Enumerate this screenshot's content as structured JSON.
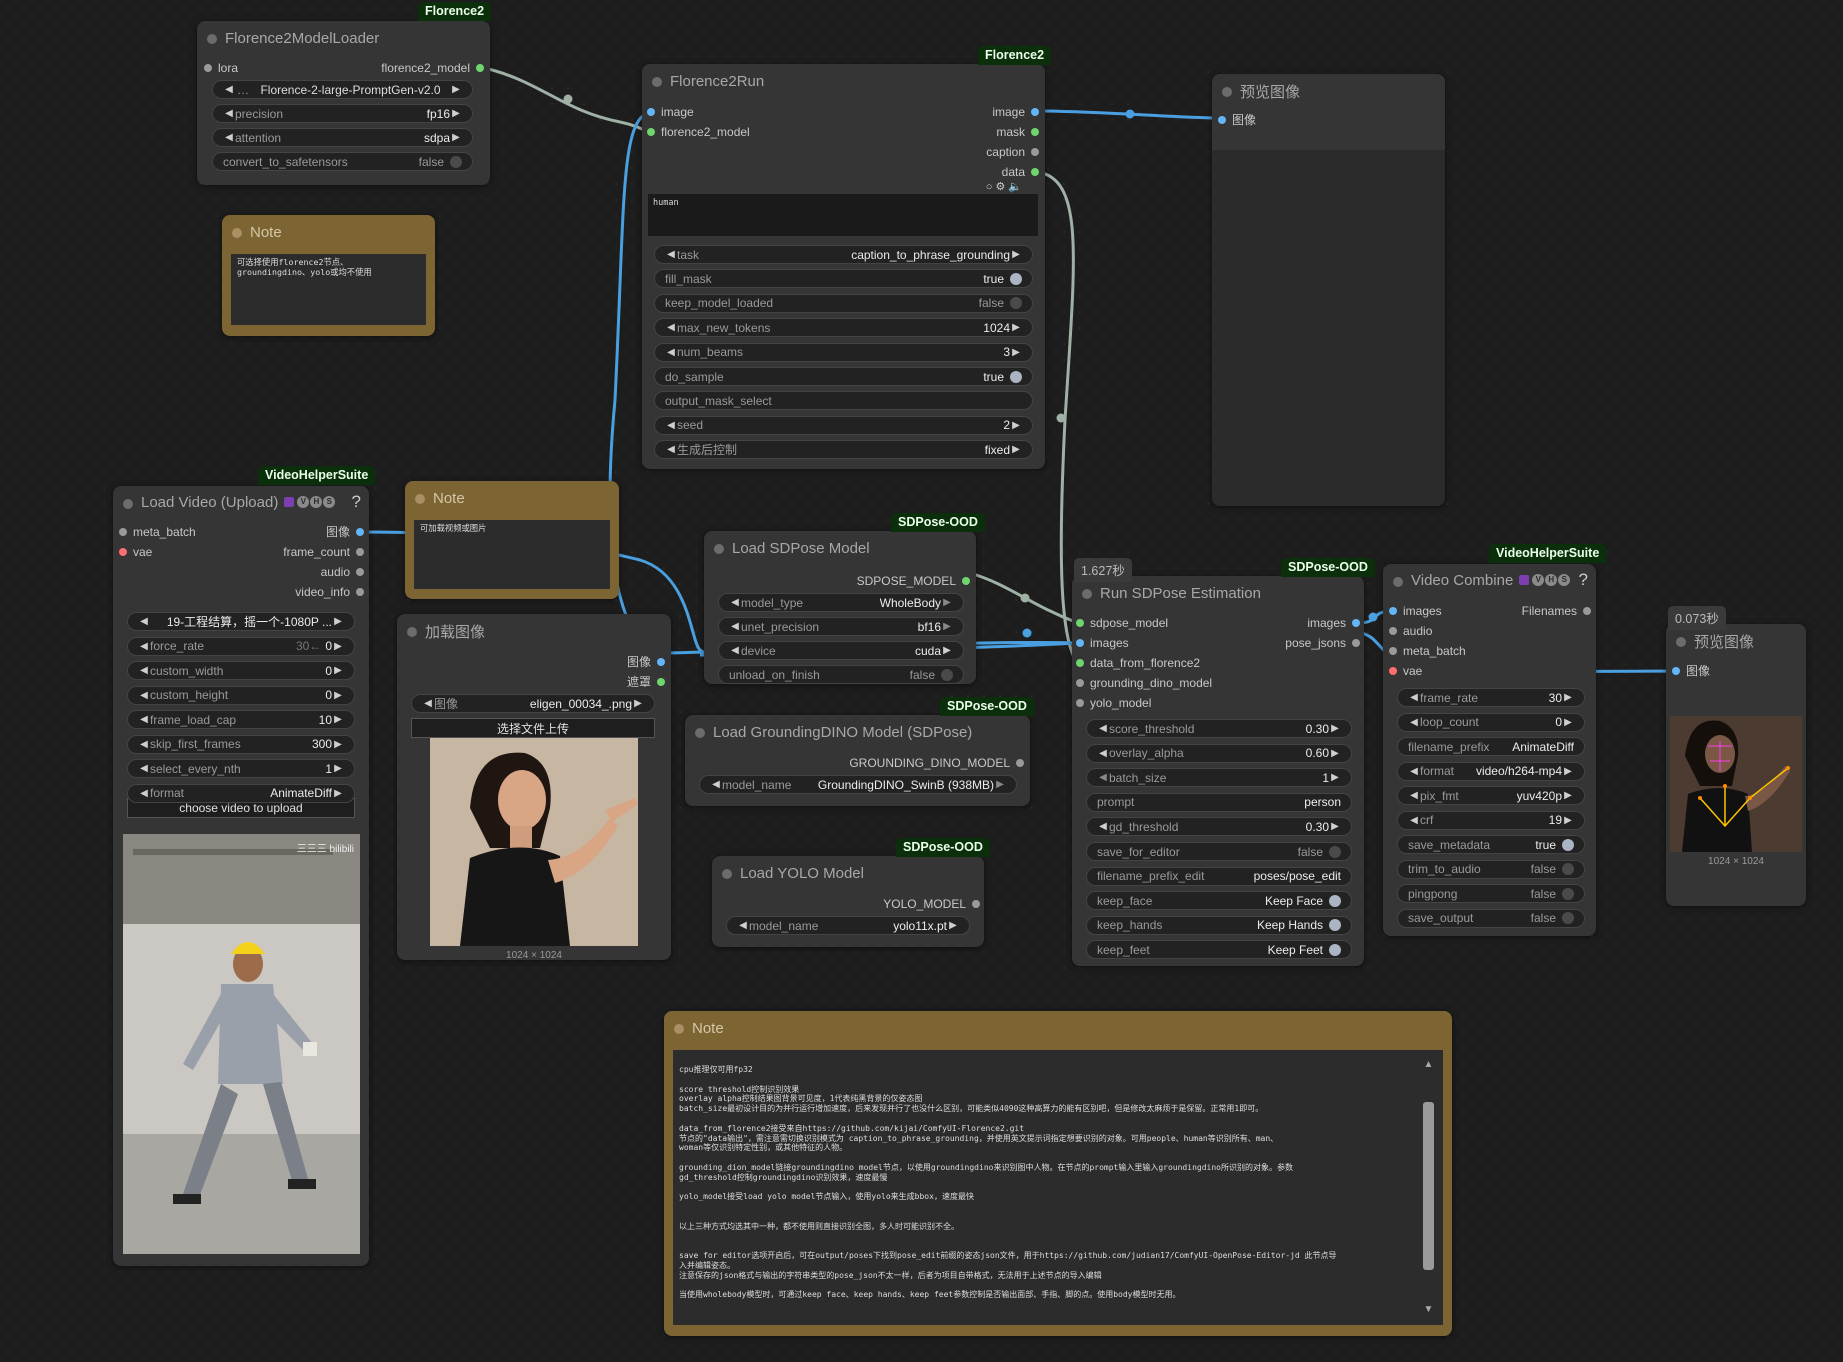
{
  "badges": {
    "florence_loader": "Florence2",
    "florence_run": "Florence2",
    "vhs_load": "VideoHelperSuite",
    "sdpose_model": "SDPose-OOD",
    "gdino": "SDPose-OOD",
    "yolo": "SDPose-OOD",
    "run_sdpose": "SDPose-OOD",
    "vhs_combine": "VideoHelperSuite"
  },
  "timings": {
    "run_sdpose": "1.627秒",
    "preview2": "0.073秒"
  },
  "florence_loader": {
    "title": "Florence2ModelLoader",
    "in_lora": "lora",
    "out_model": "florence2_model",
    "model": "Florence-2-large-PromptGen-v2.0",
    "precision_label": "precision",
    "precision": "fp16",
    "attention_label": "attention",
    "attention": "sdpa",
    "convert_label": "convert_to_safetensors",
    "convert": "false"
  },
  "note1": {
    "title": "Note",
    "text": "可选择使用florence2节点、\ngroundingdino、yolo或均不使用"
  },
  "florence_run": {
    "title": "Florence2Run",
    "in_image": "image",
    "in_model": "florence2_model",
    "out_image": "image",
    "out_mask": "mask",
    "out_caption": "caption",
    "out_data": "data",
    "text": "human",
    "widgets": [
      {
        "label": "task",
        "value": "caption_to_phrase_grounding",
        "kind": "combo"
      },
      {
        "label": "fill_mask",
        "value": "true",
        "kind": "toggle-on"
      },
      {
        "label": "keep_model_loaded",
        "value": "false",
        "kind": "toggle-off"
      },
      {
        "label": "max_new_tokens",
        "value": "1024",
        "kind": "number"
      },
      {
        "label": "num_beams",
        "value": "3",
        "kind": "number"
      },
      {
        "label": "do_sample",
        "value": "true",
        "kind": "toggle-on"
      },
      {
        "label": "output_mask_select",
        "value": "",
        "kind": "text"
      },
      {
        "label": "seed",
        "value": "2",
        "kind": "number"
      },
      {
        "label": "生成后控制",
        "value": "fixed",
        "kind": "combo"
      }
    ]
  },
  "preview1": {
    "title": "预览图像",
    "in_image": "图像"
  },
  "load_video": {
    "title": "Load Video (Upload)",
    "in_meta": "meta_batch",
    "in_vae": "vae",
    "out_image": "图像",
    "out_frame_count": "frame_count",
    "out_audio": "audio",
    "out_video_info": "video_info",
    "widgets": [
      {
        "label": "",
        "value": "19-工程结算，摇一个-1080P ...",
        "kind": "combo"
      },
      {
        "label": "force_rate",
        "value": "0",
        "hint": "30←",
        "kind": "number"
      },
      {
        "label": "custom_width",
        "value": "0",
        "kind": "number"
      },
      {
        "label": "custom_height",
        "value": "0",
        "kind": "number"
      },
      {
        "label": "frame_load_cap",
        "value": "10",
        "kind": "number"
      },
      {
        "label": "skip_first_frames",
        "value": "300",
        "kind": "number"
      },
      {
        "label": "select_every_nth",
        "value": "1",
        "kind": "number"
      },
      {
        "label": "format",
        "value": "AnimateDiff",
        "kind": "combo"
      }
    ],
    "upload_button": "choose video to upload",
    "watermark": "三三三 bilibili"
  },
  "note2": {
    "title": "Note",
    "text": "可加载视频或图片"
  },
  "load_image": {
    "title": "加载图像",
    "out_image": "图像",
    "out_mask": "遮罩",
    "image_label": "图像",
    "image_value": "eligen_00034_.png",
    "upload_button": "选择文件上传",
    "caption": "1024 × 1024"
  },
  "sdpose_loader": {
    "title": "Load SDPose Model",
    "out": "SDPOSE_MODEL",
    "model_type_label": "model_type",
    "model_type": "WholeBody",
    "unet_label": "unet_precision",
    "unet": "bf16",
    "device_label": "device",
    "device": "cuda",
    "unload_label": "unload_on_finish",
    "unload": "false"
  },
  "gdino": {
    "title": "Load GroundingDINO Model (SDPose)",
    "out": "GROUNDING_DINO_MODEL",
    "model_label": "model_name",
    "model": "GroundingDINO_SwinB (938MB)"
  },
  "yolo": {
    "title": "Load YOLO Model",
    "out": "YOLO_MODEL",
    "model_label": "model_name",
    "model": "yolo11x.pt"
  },
  "run_sdpose": {
    "title": "Run SDPose Estimation",
    "in_sdpose": "sdpose_model",
    "in_images": "images",
    "in_data": "data_from_florence2",
    "in_gdino": "grounding_dino_model",
    "in_yolo": "yolo_model",
    "out_images": "images",
    "out_pose": "pose_jsons",
    "widgets": [
      {
        "label": "score_threshold",
        "value": "0.30",
        "kind": "number"
      },
      {
        "label": "overlay_alpha",
        "value": "0.60",
        "kind": "number"
      },
      {
        "label": "batch_size",
        "value": "1",
        "kind": "number-dim"
      },
      {
        "label": "prompt",
        "value": "person",
        "kind": "text"
      },
      {
        "label": "gd_threshold",
        "value": "0.30",
        "kind": "number"
      },
      {
        "label": "save_for_editor",
        "value": "false",
        "kind": "toggle-off"
      },
      {
        "label": "filename_prefix_edit",
        "value": "poses/pose_edit",
        "kind": "text"
      },
      {
        "label": "keep_face",
        "value": "Keep Face",
        "kind": "toggle-on"
      },
      {
        "label": "keep_hands",
        "value": "Keep Hands",
        "kind": "toggle-on"
      },
      {
        "label": "keep_feet",
        "value": "Keep Feet",
        "kind": "toggle-on"
      }
    ]
  },
  "video_combine": {
    "title": "Video Combine",
    "in_images": "images",
    "in_audio": "audio",
    "in_meta": "meta_batch",
    "in_vae": "vae",
    "out_filenames": "Filenames",
    "widgets": [
      {
        "label": "frame_rate",
        "value": "30",
        "kind": "number"
      },
      {
        "label": "loop_count",
        "value": "0",
        "kind": "number"
      },
      {
        "label": "filename_prefix",
        "value": "AnimateDiff",
        "kind": "text"
      },
      {
        "label": "format",
        "value": "video/h264-mp4",
        "kind": "combo"
      },
      {
        "label": "pix_fmt",
        "value": "yuv420p",
        "kind": "combo"
      },
      {
        "label": "crf",
        "value": "19",
        "kind": "number"
      },
      {
        "label": "save_metadata",
        "value": "true",
        "kind": "toggle-on"
      },
      {
        "label": "trim_to_audio",
        "value": "false",
        "kind": "toggle-off"
      },
      {
        "label": "pingpong",
        "value": "false",
        "kind": "toggle-off"
      },
      {
        "label": "save_output",
        "value": "false",
        "kind": "toggle-off"
      }
    ]
  },
  "preview2": {
    "title": "预览图像",
    "in_image": "图像",
    "caption": "1024 × 1024"
  },
  "note3": {
    "title": "Note",
    "text": "cpu推理仅可用fp32\n\nscore threshold控制识别效果\noverlay alpha控制结果图背景可见度，1代表纯黑背景的仅姿态图\nbatch_size最初设计目的为并行运行增加速度，后来发现并行了也没什么区别，可能类似4090这种高算力的能有区别吧，但是修改太麻烦于是保留。正常用1即可。\n\ndata_from_florence2接受来自https://github.com/kijai/ComfyUI-Florence2.git\n节点的\"data输出\"，需注意需切换识别模式为 caption_to_phrase_grounding，并使用英文提示词指定想要识别的对象。可用people、human等识别所有、man、\nwoman等仅识别特定性别，或其他特征的人物。\n\ngrounding_dion_model链接groundingdino model节点，以使用groundingdino来识别图中人物。在节点的prompt输入里输入groundingdino所识别的对象。参数\ngd_threshold控制groundingdino识别效果，速度最慢\n\nyolo_model接受load yolo model节点输入，使用yolo来生成bbox，速度最快\n\n\n以上三种方式均选其中一种，都不使用则直接识别全图，多人时可能识别不全。\n\n\nsave for editor选项开启后，可在output/poses下找到pose_edit前缀的姿态json文件，用于https://github.com/judian17/ComfyUI-OpenPose-Editor-jd 此节点导\n入并编辑姿态。\n注意保存的json格式与输出的字符串类型的pose_json不太一样，后者为项目自带格式，无法用于上述节点的导入编辑\n\n当使用wholebody模型时，可通过keep face、keep hands、keep feet参数控制是否输出面部、手指、脚的点。使用body模型时无用。"
  },
  "colors": {
    "image": "#64b5f6",
    "model": "#6fd66f",
    "other": "#9a9a9a",
    "vae": "#ff6e6e",
    "wire_image": "#4a9fe0",
    "wire_grey": "#9fb0a4",
    "note": "#7c6533"
  }
}
